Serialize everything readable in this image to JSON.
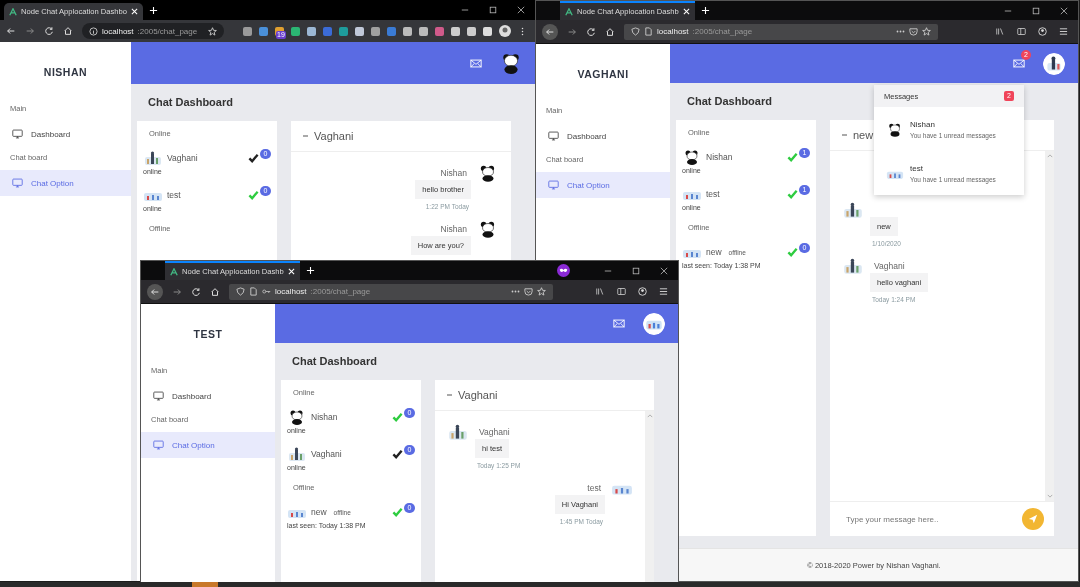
{
  "windows": [
    {
      "kind": "chrome",
      "tab_title": "Node Chat Applocation Dashbo",
      "url_host": "localhost",
      "url_path": ":2005/chat_page",
      "extension_badge": "19",
      "app": {
        "user": "NISHAN",
        "avatar": {
          "kind": "panda"
        },
        "sidebar": [
          {
            "label": "Main",
            "items": [
              {
                "label": "Dashboard",
                "selected": false
              }
            ]
          },
          {
            "label": "Chat board",
            "items": [
              {
                "label": "Chat Option",
                "selected": true
              }
            ]
          }
        ],
        "page_title": "Chat Dashboard",
        "groups": [
          {
            "label": "Online",
            "users": [
              {
                "name": "Vaghani",
                "avatar": {
                  "kind": "people"
                },
                "status": "online",
                "unread": "0",
                "color": "#222222"
              },
              {
                "name": "test",
                "avatar": {
                  "kind": "cloud"
                },
                "status": "online",
                "unread": "0",
                "color": "#2ecc40"
              }
            ]
          },
          {
            "label": "Offline"
          }
        ],
        "chat": {
          "name": "Vaghani",
          "messages": [
            {
              "kind": "sent",
              "sender": "Nishan",
              "avatar": {
                "kind": "panda"
              },
              "text": "hello brother",
              "time": "1:22 PM Today"
            },
            {
              "kind": "sent",
              "sender": "Nishan",
              "avatar": {
                "kind": "panda"
              },
              "text": "How are you?"
            }
          ]
        }
      }
    },
    {
      "kind": "firefox",
      "tab_title": "Node Chat Applocation Dashb",
      "url_host": "localhost",
      "url_path": ":2005/chat_page",
      "app": {
        "user": "VAGHANI",
        "avatar": {
          "kind": "people"
        },
        "mail_badge": "2",
        "sidebar": [
          {
            "label": "Main",
            "items": [
              {
                "label": "Dashboard",
                "selected": false
              }
            ]
          },
          {
            "label": "Chat board",
            "items": [
              {
                "label": "Chat Option",
                "selected": true
              }
            ]
          }
        ],
        "page_title": "Chat Dashboard",
        "groups": [
          {
            "label": "Online",
            "users": [
              {
                "name": "Nishan",
                "avatar": {
                  "kind": "panda"
                },
                "status": "online",
                "unread": "1",
                "color": "#2ecc40"
              },
              {
                "name": "test",
                "avatar": {
                  "kind": "cloud"
                },
                "status": "online",
                "unread": "1",
                "color": "#2ecc40"
              }
            ]
          },
          {
            "label": "Offline",
            "users": [
              {
                "name": "new",
                "tag": "offline",
                "avatar": {
                  "kind": "cloud"
                },
                "status": "last seen: Today 1:38 PM",
                "unread": "0",
                "color": "#2ecc40"
              }
            ]
          }
        ],
        "chat": {
          "name": "new",
          "messages": [
            {
              "kind": "received",
              "avatar": {
                "kind": "people"
              },
              "text": "new",
              "time": "1/10/2020"
            },
            {
              "kind": "received",
              "sender": "Vaghani",
              "avatar": {
                "kind": "people"
              },
              "text": "hello vaghani",
              "time": "Today 1:24 PM"
            }
          ],
          "composer": {
            "placeholder": "Type your message here.."
          }
        },
        "dropdown": {
          "title": "Messages",
          "count": "2",
          "items": [
            {
              "name": "Nishan",
              "avatar": {
                "kind": "panda"
              },
              "text": "You have 1 unread messages"
            },
            {
              "name": "test",
              "avatar": {
                "kind": "cloud"
              },
              "text": "You have 1 unread messages"
            }
          ]
        },
        "footer": "© 2018-2020 Power by Nishan Vaghani."
      }
    },
    {
      "kind": "firefox",
      "private": true,
      "tab_title": "Node Chat Applocation Dashb",
      "url_host": "localhost",
      "url_path": ":2005/chat_page",
      "app": {
        "user": "TEST",
        "avatar": {
          "kind": "cloud"
        },
        "sidebar": [
          {
            "label": "Main",
            "items": [
              {
                "label": "Dashboard",
                "selected": false
              }
            ]
          },
          {
            "label": "Chat board",
            "items": [
              {
                "label": "Chat Option",
                "selected": true
              }
            ]
          }
        ],
        "page_title": "Chat Dashboard",
        "groups": [
          {
            "label": "Online",
            "users": [
              {
                "name": "Nishan",
                "avatar": {
                  "kind": "panda"
                },
                "status": "online",
                "unread": "0",
                "color": "#2ecc40"
              },
              {
                "name": "Vaghani",
                "avatar": {
                  "kind": "people"
                },
                "status": "online",
                "unread": "0",
                "color": "#222222"
              }
            ]
          },
          {
            "label": "Offline",
            "users": [
              {
                "name": "new",
                "tag": "offline",
                "avatar": {
                  "kind": "cloud"
                },
                "status": "last seen: Today 1:38 PM",
                "unread": "0",
                "color": "#2ecc40"
              }
            ]
          }
        ],
        "chat": {
          "name": "Vaghani",
          "messages": [
            {
              "kind": "received",
              "sender": "Vaghani",
              "avatar": {
                "kind": "people"
              },
              "text": "hi test",
              "time": "Today 1:25 PM"
            },
            {
              "kind": "sent",
              "sender": "test",
              "avatar": {
                "kind": "cloud"
              },
              "text": "Hi Vaghani",
              "time": "1:45 PM Today"
            }
          ]
        }
      }
    }
  ]
}
